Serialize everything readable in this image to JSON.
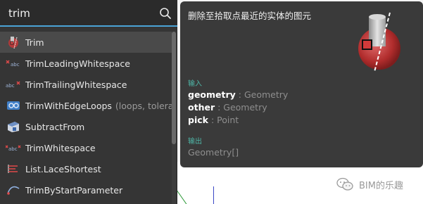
{
  "search": {
    "query": "trim",
    "icon": "search-icon"
  },
  "results": [
    {
      "label": "Trim",
      "params": "",
      "icon": "trim-sphere-icon",
      "selected": true
    },
    {
      "label": "TrimLeadingWhitespace",
      "params": "",
      "icon": "abc-leading-icon",
      "selected": false
    },
    {
      "label": "TrimTrailingWhitespace",
      "params": "",
      "icon": "abc-trailing-icon",
      "selected": false
    },
    {
      "label": "TrimWithEdgeLoops",
      "params": "(loops, toleran",
      "icon": "edge-loops-icon",
      "selected": false
    },
    {
      "label": "SubtractFrom",
      "params": "",
      "icon": "subtract-from-icon",
      "selected": false
    },
    {
      "label": "TrimWhitespace",
      "params": "",
      "icon": "abc-whitespace-icon",
      "selected": false
    },
    {
      "label": "List.LaceShortest",
      "params": "",
      "icon": "lace-shortest-icon",
      "selected": false
    },
    {
      "label": "TrimByStartParameter",
      "params": "",
      "icon": "curve-trim-icon",
      "selected": false
    }
  ],
  "detail": {
    "description": "删除至拾取点最近的实体的图元",
    "inputs_label": "输入",
    "inputs": [
      {
        "name": "geometry",
        "sep": " : ",
        "type": "Geometry"
      },
      {
        "name": "other",
        "sep": " : ",
        "type": "Geometry"
      },
      {
        "name": "pick",
        "sep": " : ",
        "type": "Point"
      }
    ],
    "outputs_label": "输出",
    "output_type": "Geometry[]",
    "preview_icon": "trim-sphere-preview-icon"
  },
  "watermark": {
    "text": "BIM的乐趣",
    "icon": "wechat-icon"
  },
  "colors": {
    "panel_bg": "#353535",
    "detail_bg": "#3a3a3a",
    "accent_blue": "#4aa3d6",
    "section_teal": "#4fb6a7",
    "sphere_red": "#c93a3a"
  }
}
